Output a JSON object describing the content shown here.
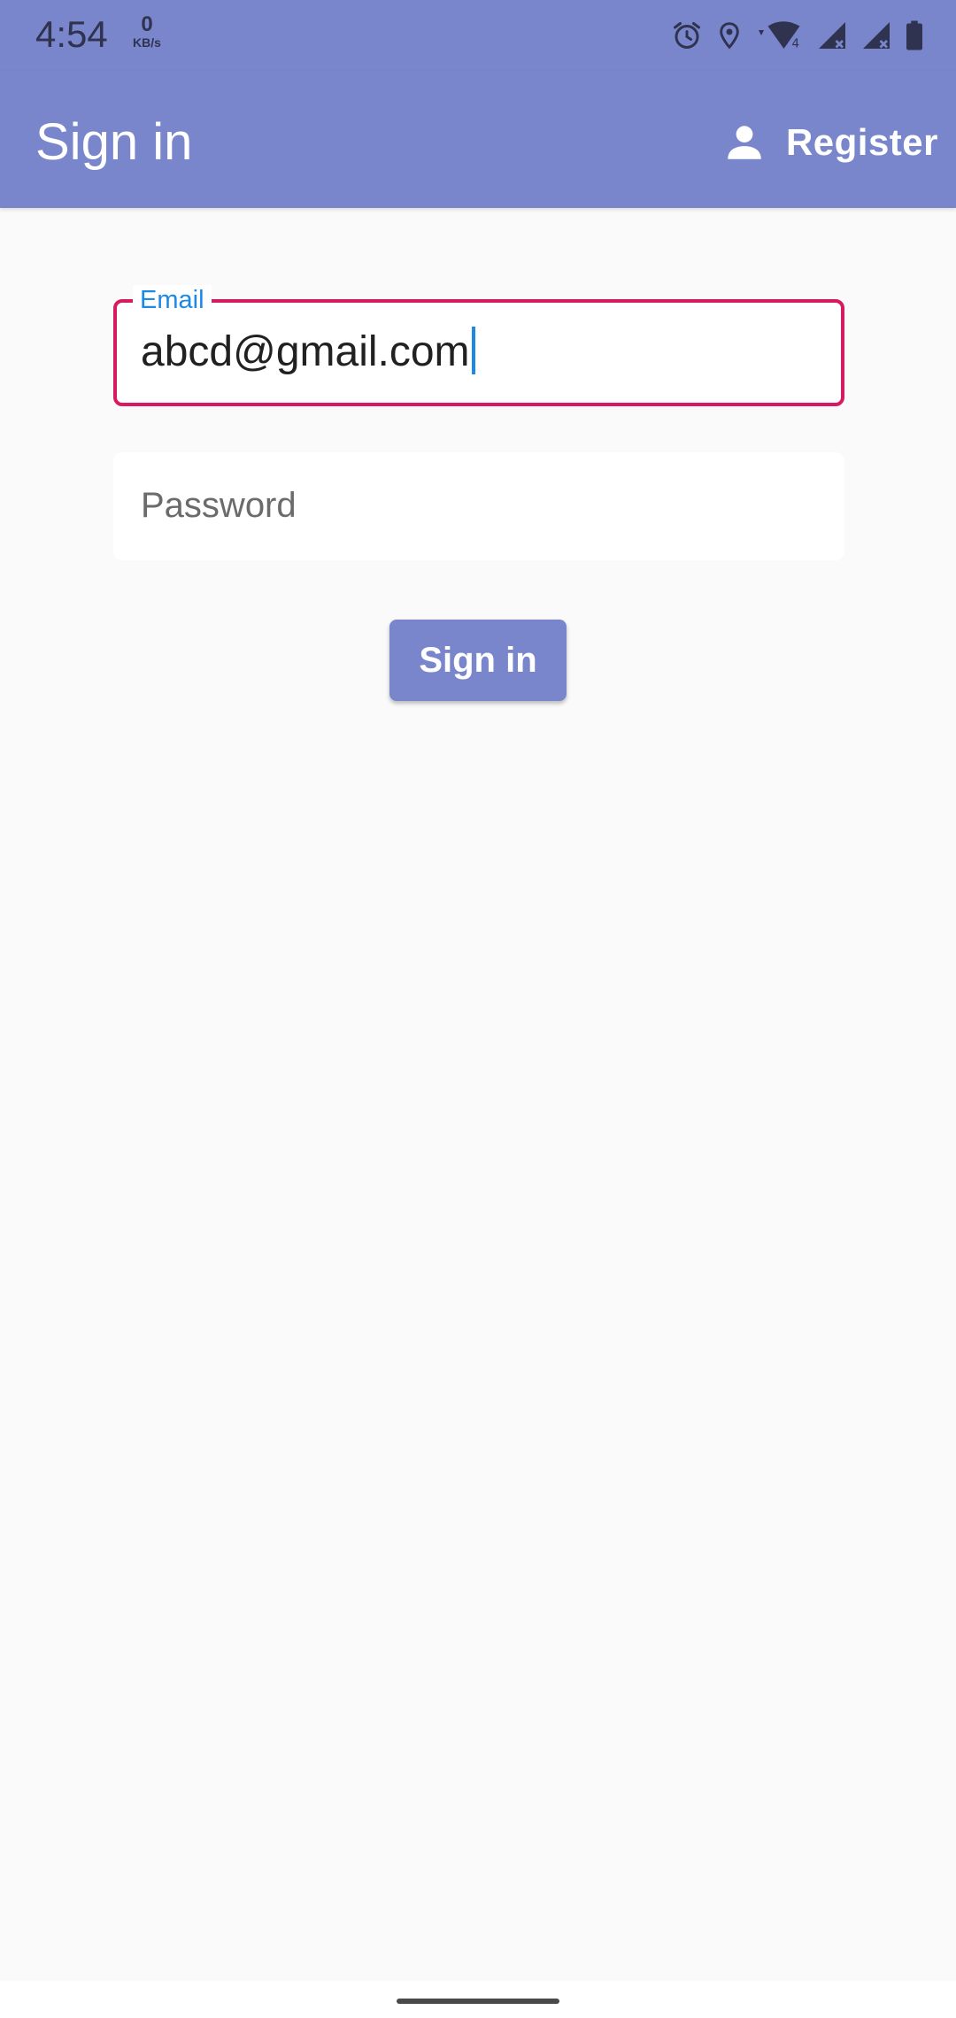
{
  "status_bar": {
    "time": "4:54",
    "net_speed_value": "0",
    "net_speed_unit": "KB/s",
    "icons": [
      "alarm-icon",
      "location-icon",
      "wifi-icon",
      "signal-icon",
      "signal-icon",
      "battery-icon"
    ]
  },
  "app_bar": {
    "title": "Sign in",
    "register_label": "Register",
    "register_icon": "person-icon"
  },
  "form": {
    "email_label": "Email",
    "email_value": "abcd@gmail.com",
    "password_placeholder": "Password",
    "submit_label": "Sign in"
  },
  "colors": {
    "primary": "#7986cb",
    "focused_border": "#d81b60",
    "label_accent": "#1e88e5",
    "background": "#fafafa"
  }
}
